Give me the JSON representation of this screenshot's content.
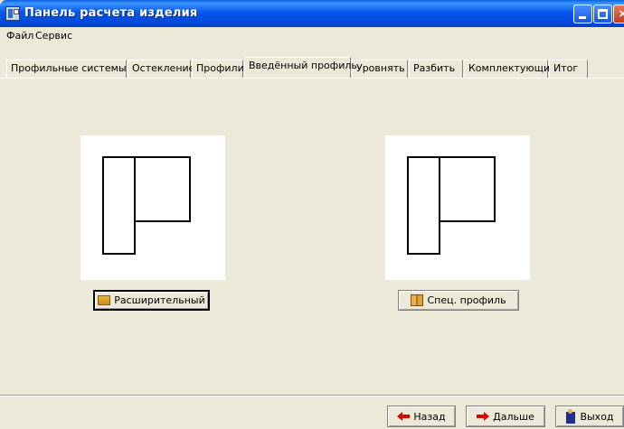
{
  "window": {
    "title": "Панель расчета изделия"
  },
  "menu": {
    "file": "Файл",
    "service": "Сервис"
  },
  "tabs": [
    {
      "label": "Профильные системы",
      "active": false
    },
    {
      "label": "Остекление",
      "active": false
    },
    {
      "label": "Профили",
      "active": false
    },
    {
      "label": "Введённый профиль",
      "active": true
    },
    {
      "label": "Уровнять",
      "active": false
    },
    {
      "label": "Разбить",
      "active": false
    },
    {
      "label": "Комплектующие",
      "active": false
    },
    {
      "label": "Итог",
      "active": false
    }
  ],
  "content": {
    "expansion_label": "Расширительный",
    "special_label": "Спец. профиль"
  },
  "footer": {
    "back_label": "Назад",
    "next_label": "Дальше",
    "exit_label": "Выход"
  },
  "icons": {
    "expansion_icon": "box-icon",
    "special_icon": "book-icon",
    "back_icon": "arrow-left-icon",
    "next_icon": "arrow-right-icon",
    "exit_icon": "door-exit-icon"
  }
}
